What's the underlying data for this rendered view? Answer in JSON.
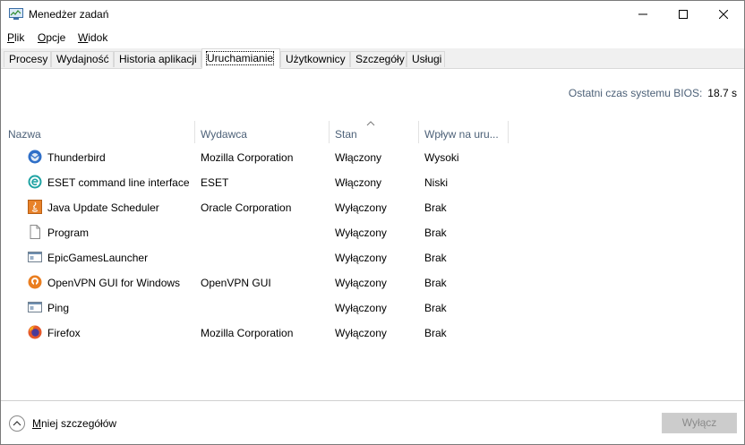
{
  "window": {
    "title": "Menedżer zadań"
  },
  "menu": {
    "items": [
      {
        "label": "Plik",
        "accel": "P",
        "rest": "lik"
      },
      {
        "label": "Opcje",
        "accel": "O",
        "rest": "pcje"
      },
      {
        "label": "Widok",
        "accel": "W",
        "rest": "idok"
      }
    ]
  },
  "tabs": [
    {
      "label": "Procesy"
    },
    {
      "label": "Wydajność"
    },
    {
      "label": "Historia aplikacji"
    },
    {
      "label": "Uruchamianie",
      "active": true
    },
    {
      "label": "Użytkownicy"
    },
    {
      "label": "Szczegóły"
    },
    {
      "label": "Usługi"
    }
  ],
  "bios": {
    "label": "Ostatni czas systemu BIOS:",
    "value": "18.7 s"
  },
  "columns": {
    "name": "Nazwa",
    "publisher": "Wydawca",
    "status": "Stan",
    "impact": "Wpływ na uru..."
  },
  "rows": [
    {
      "name": "Thunderbird",
      "publisher": "Mozilla Corporation",
      "status": "Włączony",
      "impact": "Wysoki",
      "icon": "thunderbird-icon"
    },
    {
      "name": "ESET command line interface",
      "publisher": "ESET",
      "status": "Włączony",
      "impact": "Niski",
      "icon": "eset-icon"
    },
    {
      "name": "Java Update Scheduler",
      "publisher": "Oracle Corporation",
      "status": "Wyłączony",
      "impact": "Brak",
      "icon": "java-icon"
    },
    {
      "name": "Program",
      "publisher": "",
      "status": "Wyłączony",
      "impact": "Brak",
      "icon": "blank-file-icon"
    },
    {
      "name": "EpicGamesLauncher",
      "publisher": "",
      "status": "Wyłączony",
      "impact": "Brak",
      "icon": "app-window-icon"
    },
    {
      "name": "OpenVPN GUI for Windows",
      "publisher": "OpenVPN GUI",
      "status": "Wyłączony",
      "impact": "Brak",
      "icon": "openvpn-icon"
    },
    {
      "name": "Ping",
      "publisher": "",
      "status": "Wyłączony",
      "impact": "Brak",
      "icon": "app-window-icon"
    },
    {
      "name": "Firefox",
      "publisher": "Mozilla Corporation",
      "status": "Wyłączony",
      "impact": "Brak",
      "icon": "firefox-icon"
    }
  ],
  "footer": {
    "fewer_details": "Mniej szczegółów",
    "fewer_accel": "M",
    "fewer_rest": "niej szczegółów",
    "disable_button": "Wyłącz"
  }
}
